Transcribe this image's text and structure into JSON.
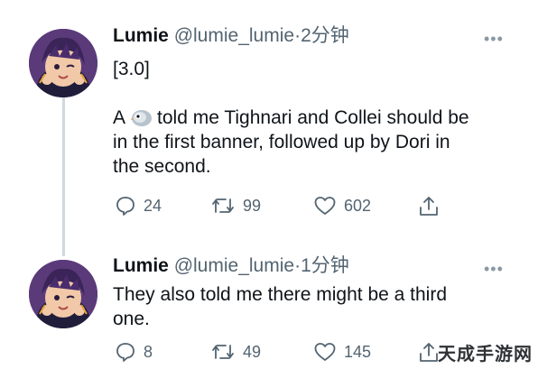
{
  "tweets": [
    {
      "name": "Lumie",
      "handle": "@lumie_lumie",
      "separator": "·",
      "time": "2分钟",
      "lines": [
        "[3.0]",
        "",
        "A      told me Tighnari and Collei should be",
        "in the first banner, followed up by Dori in",
        "the second."
      ],
      "reply_count": "24",
      "retweet_count": "99",
      "like_count": "602"
    },
    {
      "name": "Lumie",
      "handle": "@lumie_lumie",
      "separator": "·",
      "time": "1分钟",
      "lines": [
        "They also told me there might be a third",
        "one."
      ],
      "reply_count": "8",
      "retweet_count": "49",
      "like_count": "145"
    }
  ],
  "watermark": "天成手游网",
  "icons": {
    "more": "more-horizontal-icon",
    "reply": "reply-icon",
    "retweet": "retweet-icon",
    "like": "heart-icon",
    "share": "share-icon",
    "inline_emoji": "bird-emoji-icon"
  }
}
